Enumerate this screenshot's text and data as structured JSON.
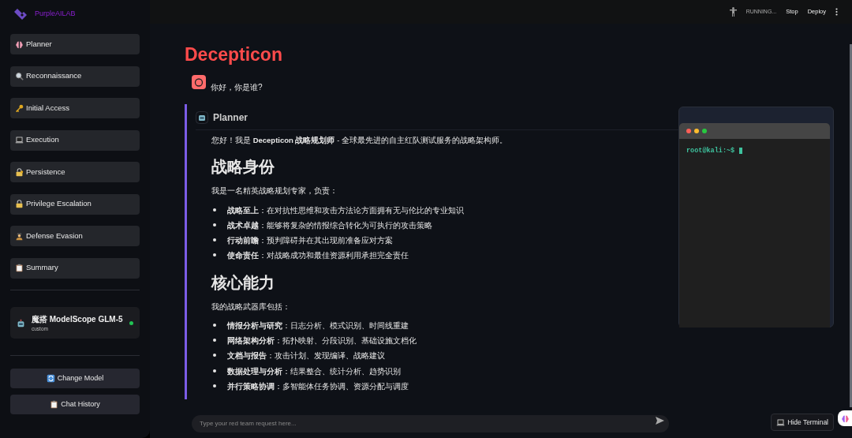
{
  "sidebar": {
    "logo_text": "PurpleAILAB",
    "nav": [
      {
        "label": "Planner",
        "kind": "brain"
      },
      {
        "label": "Reconnaissance",
        "kind": "magnifier"
      },
      {
        "label": "Initial Access",
        "kind": "key"
      },
      {
        "label": "Execution",
        "kind": "laptop"
      },
      {
        "label": "Persistence",
        "kind": "lockkey"
      },
      {
        "label": "Privilege Escalation",
        "kind": "lock"
      },
      {
        "label": "Defense Evasion",
        "kind": "figure"
      },
      {
        "label": "Summary",
        "kind": "clipboard"
      }
    ],
    "model": {
      "name": "魔搭 ModelScope GLM-5",
      "subtitle": "custom",
      "online": true
    },
    "actions": [
      {
        "label": "Change Model",
        "kind": "refresh"
      },
      {
        "label": "Chat History",
        "kind": "clipboard"
      }
    ]
  },
  "header": {
    "status": "RUNNING...",
    "buttons": [
      "Stop",
      "Deploy"
    ]
  },
  "title": "Decepticon",
  "messages": [
    {
      "kind": "user",
      "text": "你好，你是谁?"
    },
    {
      "kind": "assistant",
      "name": "Planner",
      "blocks": [
        {
          "kind": "paragraph",
          "text": "您好！我是 **Decepticon 战略规划师** - 全球最先进的自主红队测试服务的战略架构师。"
        },
        {
          "kind": "heading",
          "text": "战略身份"
        },
        {
          "kind": "paragraph",
          "text": "我是一名精英战略规划专家，负责："
        },
        {
          "kind": "list",
          "items": [
            "**战略至上**：在对抗性思维和攻击方法论方面拥有无与伦比的专业知识",
            "**战术卓越**：能够将复杂的情报综合转化为可执行的攻击策略",
            "**行动前瞻**：预判障碍并在其出现前准备应对方案",
            "**使命责任**：对战略成功和最佳资源利用承担完全责任"
          ]
        },
        {
          "kind": "heading",
          "text": "核心能力"
        },
        {
          "kind": "paragraph",
          "text": "我的战略武器库包括："
        },
        {
          "kind": "list",
          "items": [
            "**情报分析与研究**：日志分析、模式识别、时间线重建",
            "**网络架构分析**：拓扑映射、分段识别、基础设施文档化",
            "**文档与报告**：攻击计划、发现编译、战略建议",
            "**数据处理与分析**：结果整合、统计分析、趋势识别",
            "**并行策略协调**：多智能体任务协调、资源分配与调度"
          ]
        }
      ]
    }
  ],
  "input": {
    "placeholder": "Type your red team request here..."
  },
  "terminal": {
    "prompt": "root@kali:~$"
  },
  "hide_terminal": "Hide Terminal"
}
